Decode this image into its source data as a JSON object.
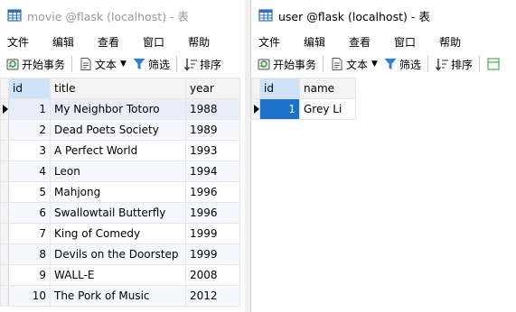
{
  "movie_window": {
    "title": "movie @flask (localhost) - 表",
    "menu": [
      "文件",
      "编辑",
      "查看",
      "窗口",
      "帮助"
    ],
    "toolbar": {
      "begin_transaction": "开始事务",
      "text": "文本",
      "filter": "筛选",
      "sort": "排序"
    },
    "columns": [
      "id",
      "title",
      "year"
    ],
    "rows": [
      {
        "id": "1",
        "title": "My Neighbor Totoro",
        "year": "1988"
      },
      {
        "id": "2",
        "title": "Dead Poets Society",
        "year": "1989"
      },
      {
        "id": "3",
        "title": "A Perfect World",
        "year": "1993"
      },
      {
        "id": "4",
        "title": "Leon",
        "year": "1994"
      },
      {
        "id": "5",
        "title": "Mahjong",
        "year": "1996"
      },
      {
        "id": "6",
        "title": "Swallowtail Butterfly",
        "year": "1996"
      },
      {
        "id": "7",
        "title": "King of Comedy",
        "year": "1999"
      },
      {
        "id": "8",
        "title": "Devils on the Doorstep",
        "year": "1999"
      },
      {
        "id": "9",
        "title": "WALL-E",
        "year": "2008"
      },
      {
        "id": "10",
        "title": "The Pork of Music",
        "year": "2012"
      }
    ]
  },
  "user_window": {
    "title": "user @flask (localhost) - 表",
    "menu": [
      "文件",
      "编辑",
      "查看",
      "窗口",
      "帮助"
    ],
    "toolbar": {
      "begin_transaction": "开始事务",
      "text": "文本",
      "filter": "筛选",
      "sort": "排序"
    },
    "columns": [
      "id",
      "name"
    ],
    "rows": [
      {
        "id": "1",
        "name": "Grey Li"
      }
    ]
  },
  "colors": {
    "selection": "#1e70cd",
    "filter_icon": "#2b7fd8",
    "table_icon": "#2f6fb8"
  }
}
